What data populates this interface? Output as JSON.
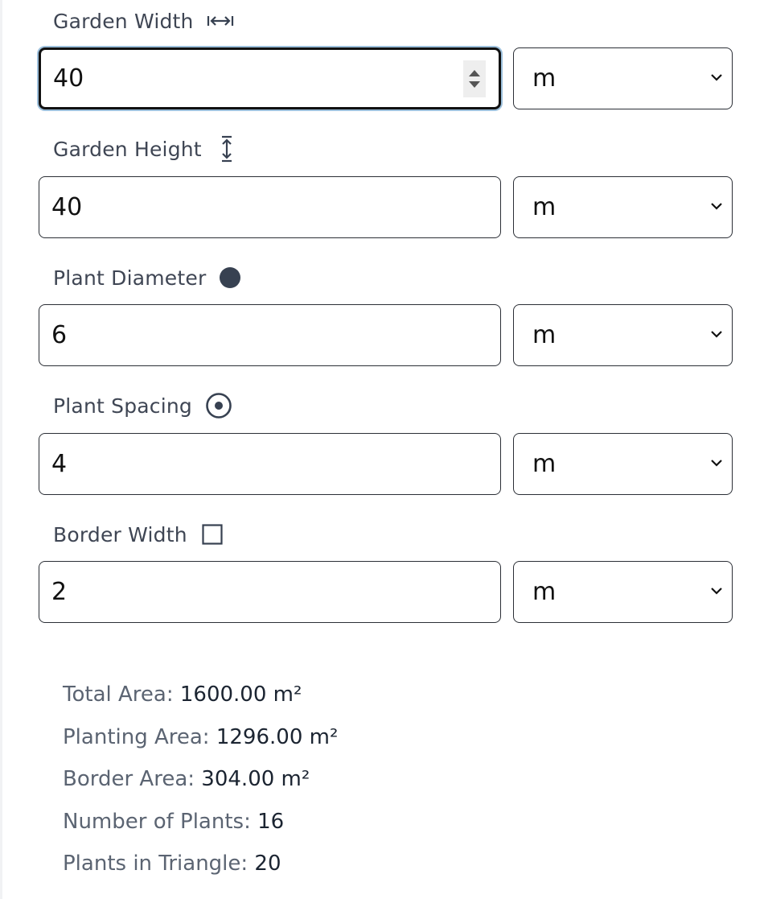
{
  "colors": {
    "label": "#3f4654",
    "border": "#2b2f36",
    "focus_ring": "#9dc0dc",
    "icon": "#374151"
  },
  "fields": [
    {
      "label": "Garden Width",
      "icon": "arrows-horizontal-icon",
      "value": "40",
      "unit": "m",
      "focused": true
    },
    {
      "label": "Garden Height",
      "icon": "arrows-vertical-icon",
      "value": "40",
      "unit": "m",
      "focused": false
    },
    {
      "label": "Plant Diameter",
      "icon": "filled-circle-icon",
      "value": "6",
      "unit": "m",
      "focused": false
    },
    {
      "label": "Plant Spacing",
      "icon": "target-icon",
      "value": "4",
      "unit": "m",
      "focused": false
    },
    {
      "label": "Border Width",
      "icon": "square-outline-icon",
      "value": "2",
      "unit": "m",
      "focused": false
    }
  ],
  "results": [
    {
      "label": "Total Area:",
      "value": "1600.00 m²"
    },
    {
      "label": "Planting Area:",
      "value": "1296.00 m²"
    },
    {
      "label": "Border Area:",
      "value": "304.00 m²"
    },
    {
      "label": "Number of Plants:",
      "value": "16"
    },
    {
      "label": "Plants in Triangle:",
      "value": "20"
    }
  ]
}
